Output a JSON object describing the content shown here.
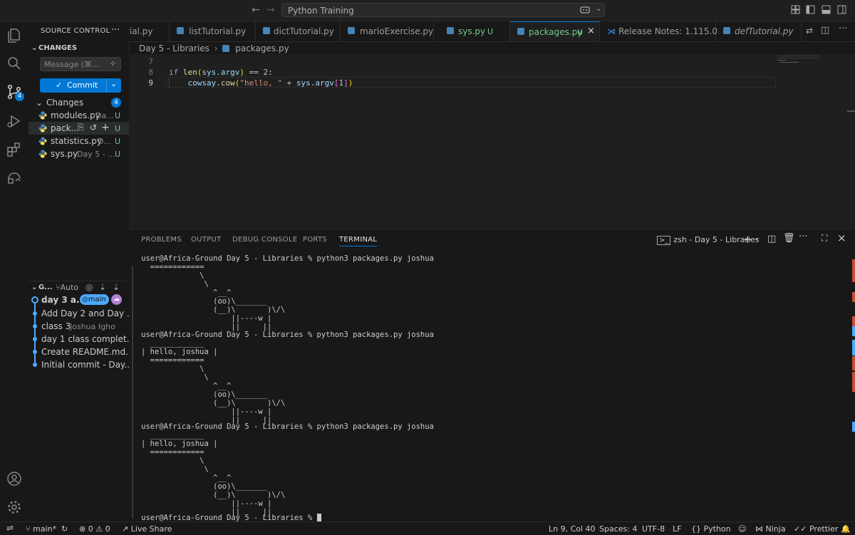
{
  "window": {
    "search_text": "Python Training"
  },
  "activity": {
    "scm_badge": "4"
  },
  "sidebar": {
    "title": "SOURCE CONTROL",
    "changes_header": "CHANGES",
    "message_placeholder": "Message (⌘...",
    "commit_label": "Commit",
    "changes_group": "Changes",
    "changes_count": "4",
    "files": [
      {
        "name": "modules.py",
        "dir": "Da...",
        "status": "U"
      },
      {
        "name": "pack...",
        "dir": "",
        "status": "U"
      },
      {
        "name": "statistics.py",
        "dir": "D...",
        "status": "U"
      },
      {
        "name": "sys.py",
        "dir": "Day 5 - ...",
        "status": "U"
      }
    ],
    "graph_header": "G...",
    "graph_auto": "Auto",
    "commits": [
      {
        "msg": "day 3 a...",
        "branch": "main"
      },
      {
        "msg": "Add Day 2 and Day ..."
      },
      {
        "msg": "class 3",
        "author": "Joshua Igho"
      },
      {
        "msg": "day 1 class complet..."
      },
      {
        "msg": "Create README.md..."
      },
      {
        "msg": "Initial commit - Day..."
      }
    ]
  },
  "tabs": [
    {
      "label": "rial.py"
    },
    {
      "label": "listTutorial.py"
    },
    {
      "label": "dictTutorial.py"
    },
    {
      "label": "marioExercise.py"
    },
    {
      "label": "sys.py",
      "status": "U"
    },
    {
      "label": "packages.py",
      "status": "U"
    },
    {
      "label": "Release Notes: 1.115.0"
    },
    {
      "label": "defTutorial.py"
    }
  ],
  "breadcrumb": {
    "folder": "Day 5 - Libraries",
    "file": "packages.py"
  },
  "editor": {
    "line_numbers": [
      "7",
      "8",
      "9"
    ],
    "line8": {
      "kw": "if ",
      "fn": "len",
      "p1": "(",
      "v1": "sys",
      "dot": ".",
      "v2": "argv",
      "p2": ")",
      "op": " == ",
      "num": "2",
      "colon": ":"
    },
    "line9": {
      "indent": "    ",
      "v1": "cowsay",
      "dot": ".",
      "fn": "cow",
      "p1": "(",
      "str": "\"hello, \"",
      "plus": " + ",
      "v2": "sys",
      "dot2": ".",
      "v3": "argv",
      "b1": "[",
      "num": "1",
      "b2": "]",
      "p2": ")"
    }
  },
  "panel": {
    "tabs": [
      "PROBLEMS",
      "OUTPUT",
      "DEBUG CONSOLE",
      "PORTS",
      "TERMINAL"
    ],
    "terminal_name": "zsh - Day 5 - Libraries",
    "lines": [
      "user@Africa-Ground Day 5 - Libraries % python3 packages.py joshua",
      "  ============",
      "             \\",
      "              \\",
      "                ^__^",
      "                (oo)\\_______",
      "                (__)\\       )\\/\\",
      "                    ||----w |",
      "                    ||     ||",
      "user@Africa-Ground Day 5 - Libraries % python3 packages.py joshua",
      "  ____________",
      "| hello, joshua |",
      "  ============",
      "             \\",
      "              \\",
      "                ^__^",
      "                (oo)\\_______",
      "                (__)\\       )\\/\\",
      "                    ||----w |",
      "                    ||     ||",
      "user@Africa-Ground Day 5 - Libraries % python3 packages.py joshua",
      "  ____________",
      "| hello, joshua |",
      "  ============",
      "             \\",
      "              \\",
      "                ^__^",
      "                (oo)\\_______",
      "                (__)\\       )\\/\\",
      "                    ||----w |",
      "                    ||     ||",
      "user@Africa-Ground Day 5 - Libraries % "
    ]
  },
  "status": {
    "branch": "main*",
    "errors": "0",
    "warnings": "0",
    "live_share": "Live Share",
    "position": "Ln 9, Col 40",
    "spaces": "Spaces: 4",
    "encoding": "UTF-8",
    "eol": "LF",
    "language": "Python",
    "ninja": "Ninja",
    "prettier": "Prettier"
  },
  "colors": {
    "accent": "#0078d4",
    "untracked": "#73c991",
    "graph": "#4daafc"
  }
}
